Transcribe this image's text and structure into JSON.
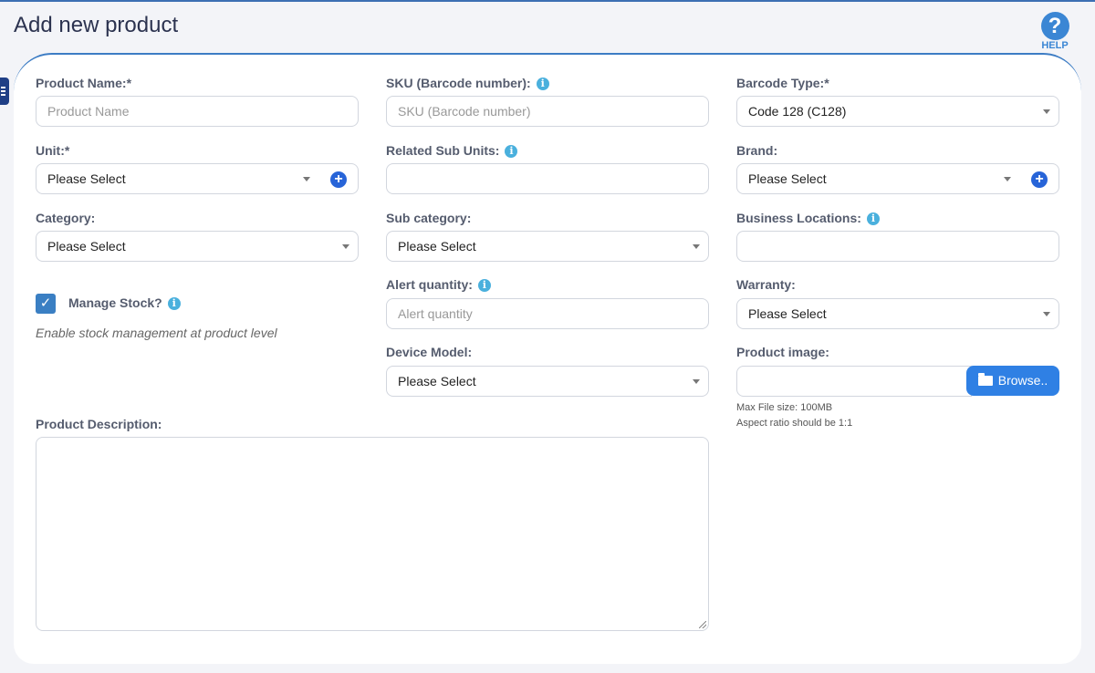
{
  "page": {
    "title": "Add new product",
    "help_label": "HELP",
    "help_glyph": "?"
  },
  "accent_color": "#2f80e4",
  "form": {
    "product_name": {
      "label": "Product Name:*",
      "placeholder": "Product Name"
    },
    "sku": {
      "label": "SKU (Barcode number):",
      "placeholder": "SKU (Barcode number)"
    },
    "barcode_type": {
      "label": "Barcode Type:*",
      "value": "Code 128 (C128)"
    },
    "unit": {
      "label": "Unit:*",
      "value": "Please Select"
    },
    "related_sub_units": {
      "label": "Related Sub Units:",
      "value": ""
    },
    "brand": {
      "label": "Brand:",
      "value": "Please Select"
    },
    "category": {
      "label": "Category:",
      "value": "Please Select"
    },
    "sub_category": {
      "label": "Sub category:",
      "value": "Please Select"
    },
    "business_locations": {
      "label": "Business Locations:",
      "value": ""
    },
    "manage_stock": {
      "label": "Manage Stock?",
      "checked": true,
      "help": "Enable stock management at product level"
    },
    "alert_quantity": {
      "label": "Alert quantity:",
      "placeholder": "Alert quantity"
    },
    "warranty": {
      "label": "Warranty:",
      "value": "Please Select"
    },
    "device_model": {
      "label": "Device Model:",
      "value": "Please Select"
    },
    "product_image": {
      "label": "Product image:",
      "browse_label": "Browse..",
      "max_size_note": "Max File size: 100MB",
      "aspect_note": "Aspect ratio should be 1:1"
    },
    "product_description": {
      "label": "Product Description:",
      "value": ""
    }
  },
  "icons": {
    "info": "info-icon",
    "add": "plus-circle-icon",
    "folder": "folder-open-icon",
    "check": "checkmark-icon"
  }
}
